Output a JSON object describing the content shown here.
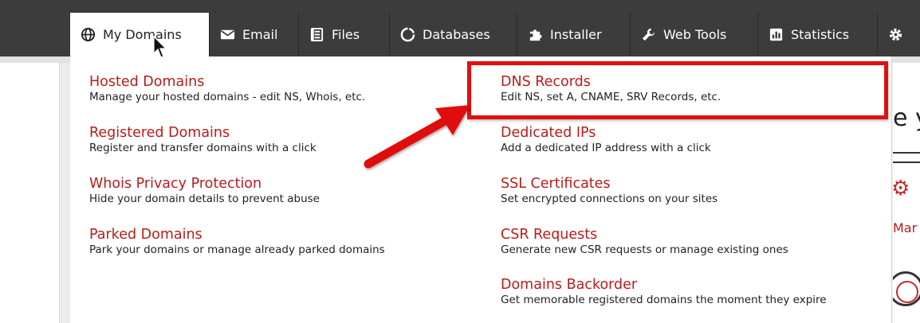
{
  "nav": {
    "tabs": [
      {
        "label": "My Domains",
        "icon": "globe-icon"
      },
      {
        "label": "Email",
        "icon": "envelope-icon"
      },
      {
        "label": "Files",
        "icon": "files-icon"
      },
      {
        "label": "Databases",
        "icon": "database-icon"
      },
      {
        "label": "Installer",
        "icon": "puzzle-icon"
      },
      {
        "label": "Web Tools",
        "icon": "wrench-icon"
      },
      {
        "label": "Statistics",
        "icon": "chart-icon"
      },
      {
        "label": "",
        "icon": "gear-icon"
      }
    ]
  },
  "dropdown": {
    "left": [
      {
        "title": "Hosted Domains",
        "desc": "Manage your hosted domains - edit NS, Whois, etc."
      },
      {
        "title": "Registered Domains",
        "desc": "Register and transfer domains with a click"
      },
      {
        "title": "Whois Privacy Protection",
        "desc": "Hide your domain details to prevent abuse"
      },
      {
        "title": "Parked Domains",
        "desc": "Park your domains or manage already parked domains"
      }
    ],
    "right": [
      {
        "title": "DNS Records",
        "desc": "Edit NS, set A, CNAME, SRV Records, etc."
      },
      {
        "title": "Dedicated IPs",
        "desc": "Add a dedicated IP address with a click"
      },
      {
        "title": "SSL Certificates",
        "desc": "Set encrypted connections on your sites"
      },
      {
        "title": "CSR Requests",
        "desc": "Generate new CSR requests or manage existing ones"
      },
      {
        "title": "Domains Backorder",
        "desc": "Get memorable registered domains the moment they expire"
      }
    ]
  },
  "background": {
    "heading_fragment": "e y",
    "link_fragment": "Mar"
  },
  "colors": {
    "nav_bg": "#3c3c3c",
    "link": "#b71c1c",
    "highlight": "#e01010"
  }
}
